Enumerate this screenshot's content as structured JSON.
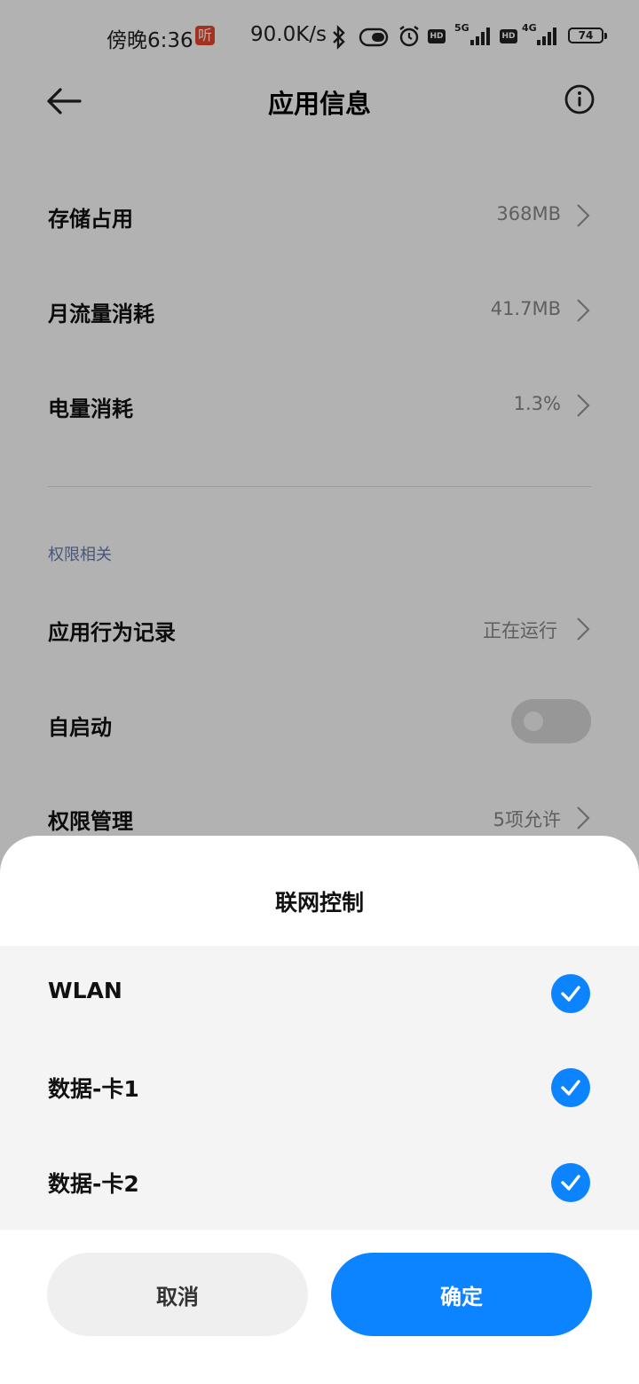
{
  "status_bar": {
    "time": "傍晚6:36",
    "app_badge": "听",
    "net_speed": "90.0K/s",
    "net1": "5G",
    "net2": "4G",
    "hd": "HD",
    "battery": "74"
  },
  "header": {
    "title": "应用信息"
  },
  "rows": {
    "storage": {
      "label": "存储占用",
      "value": "368MB"
    },
    "traffic": {
      "label": "月流量消耗",
      "value": "41.7MB"
    },
    "battery": {
      "label": "电量消耗",
      "value": "1.3%"
    }
  },
  "permissions_section": {
    "heading": "权限相关",
    "behavior": {
      "label": "应用行为记录",
      "value": "正在运行"
    },
    "autostart": {
      "label": "自启动",
      "enabled": false
    },
    "manage": {
      "label": "权限管理",
      "value": "5项允许"
    }
  },
  "dialog": {
    "title": "联网控制",
    "options": [
      {
        "label": "WLAN",
        "checked": true
      },
      {
        "label": "数据-卡1",
        "checked": true
      },
      {
        "label": "数据-卡2",
        "checked": true
      }
    ],
    "cancel_label": "取消",
    "ok_label": "确定"
  },
  "colors": {
    "accent": "#0d84ff",
    "section_heading": "#6b7cab",
    "overlay": "rgba(0,0,0,0.30)"
  }
}
